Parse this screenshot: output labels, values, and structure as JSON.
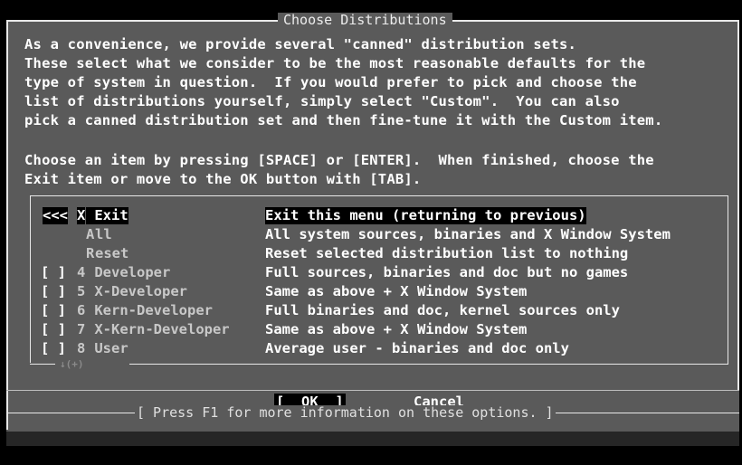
{
  "dialog": {
    "title": "Choose Distributions",
    "intro": [
      "As a convenience, we provide several \"canned\" distribution sets.",
      "These select what we consider to be the most reasonable defaults for the",
      "type of system in question.  If you would prefer to pick and choose the",
      "list of distributions yourself, simply select \"Custom\".  You can also",
      "pick a canned distribution set and then fine-tune it with the Custom item."
    ],
    "instructions": [
      "Choose an item by pressing [SPACE] or [ENTER].  When finished, choose the",
      "Exit item or move to the OK button with [TAB]."
    ]
  },
  "list": {
    "selected_marker": "<<<",
    "more_indicator": "↓(+)",
    "items": [
      {
        "check": "",
        "hotkey": "X",
        "label": " Exit",
        "desc": "Exit this menu (returning to previous)",
        "selected": true
      },
      {
        "check": "",
        "hotkey": "A",
        "label": "ll",
        "desc": "All system sources, binaries and X Window System",
        "selected": false
      },
      {
        "check": "",
        "hotkey": "R",
        "label": "eset",
        "desc": "Reset selected distribution list to nothing",
        "selected": false
      },
      {
        "check": "[ ]",
        "hotkey": "4",
        "label": " Developer",
        "desc": "Full sources, binaries and doc but no games",
        "selected": false
      },
      {
        "check": "[ ]",
        "hotkey": "5",
        "label": " X-Developer",
        "desc": "Same as above + X Window System",
        "selected": false
      },
      {
        "check": "[ ]",
        "hotkey": "6",
        "label": " Kern-Developer",
        "desc": "Full binaries and doc, kernel sources only",
        "selected": false
      },
      {
        "check": "[ ]",
        "hotkey": "7",
        "label": " X-Kern-Developer",
        "desc": "Same as above + X Window System",
        "selected": false
      },
      {
        "check": "[ ]",
        "hotkey": "8",
        "label": " User",
        "desc": "Average user - binaries and doc only",
        "selected": false
      }
    ]
  },
  "buttons": {
    "ok": "[  OK  ]",
    "cancel": "Cancel"
  },
  "footer": {
    "hint": "[ Press F1 for more information on these options. ]"
  }
}
